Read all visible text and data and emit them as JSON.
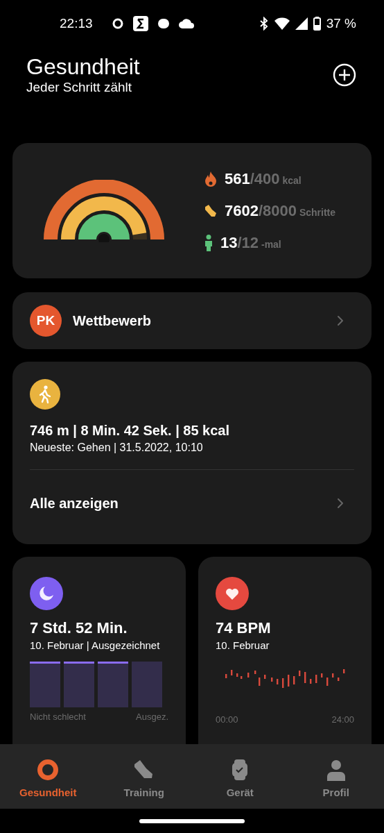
{
  "status_bar": {
    "time": "22:13",
    "battery": "37 %"
  },
  "header": {
    "title": "Gesundheit",
    "subtitle": "Jeder Schritt zählt"
  },
  "activity": {
    "rings": [
      {
        "kind": "calories",
        "color": "#e26a32"
      },
      {
        "kind": "steps",
        "color": "#f2b84b"
      },
      {
        "kind": "standing",
        "color": "#5cc27a"
      }
    ],
    "stats": [
      {
        "kind": "calories",
        "value": "561",
        "goal": "/400",
        "unit": "kcal"
      },
      {
        "kind": "steps",
        "value": "7602",
        "goal": "/8000",
        "unit": "Schritte"
      },
      {
        "kind": "standing",
        "value": "13",
        "goal": "/12",
        "unit": "-mal"
      }
    ]
  },
  "competition": {
    "badge": "PK",
    "label": "Wettbewerb"
  },
  "workout": {
    "summary": "746 m | 8 Min. 42 Sek. | 85 kcal",
    "detail": "Neueste: Gehen | 31.5.2022, 10:10",
    "link": "Alle anzeigen"
  },
  "sleep": {
    "value": "7 Std. 52 Min.",
    "detail": "10. Februar | Ausgezeichnet",
    "scale_labels": [
      "Nicht schlecht",
      "Ausgez."
    ]
  },
  "heart_rate": {
    "value": "74 BPM",
    "detail": "10. Februar",
    "axis_labels": [
      "00:00",
      "24:00"
    ]
  },
  "nav": {
    "items": [
      {
        "kind": "health",
        "label": "Gesundheit",
        "selected": true
      },
      {
        "kind": "training",
        "label": "Training",
        "selected": false
      },
      {
        "kind": "device",
        "label": "Gerät",
        "selected": false
      },
      {
        "kind": "profile",
        "label": "Profil",
        "selected": false
      }
    ]
  }
}
